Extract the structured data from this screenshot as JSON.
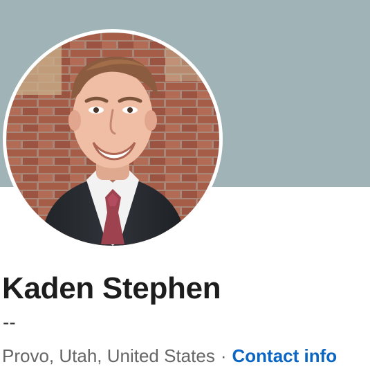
{
  "profile": {
    "name": "Kaden Stephen",
    "headline": "--",
    "location": "Provo, Utah, United States",
    "separator": "·",
    "contact_info_label": "Contact info"
  },
  "colors": {
    "cover_background": "#a0b4b7",
    "link": "#0a66c2",
    "name_text": "#1d1d1d",
    "secondary_text": "#666666"
  }
}
